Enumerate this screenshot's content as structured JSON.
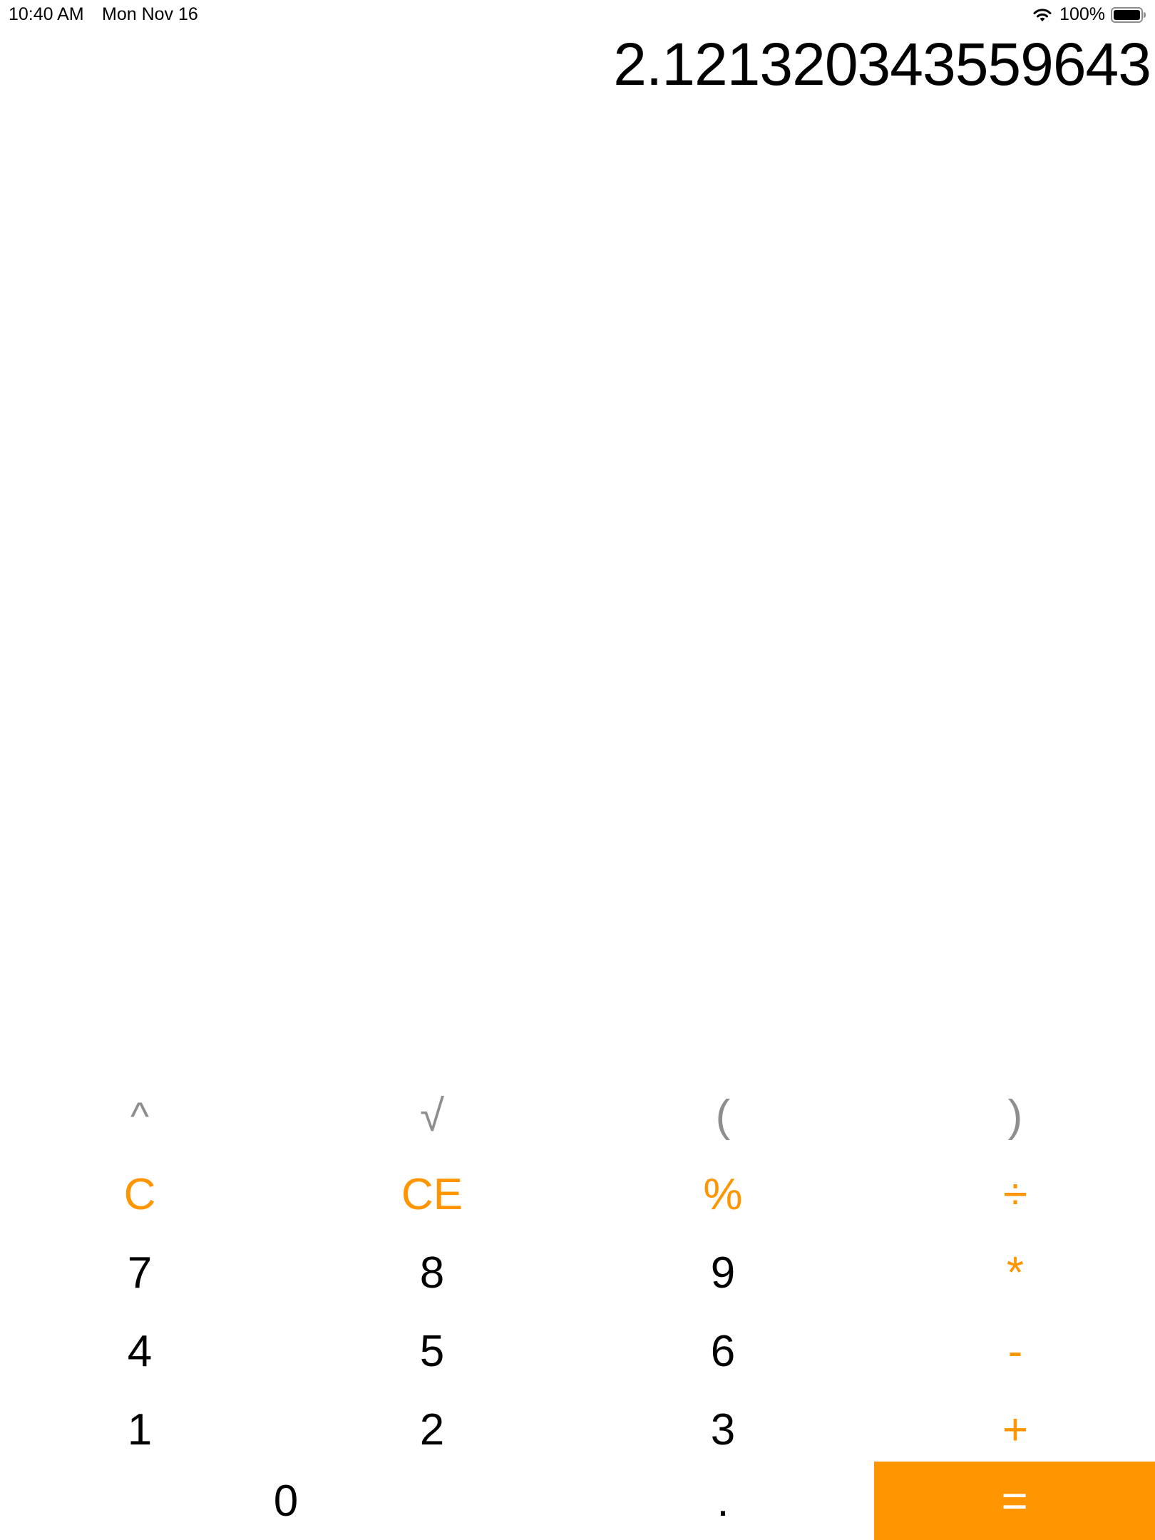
{
  "status_bar": {
    "time": "10:40 AM",
    "date": "Mon Nov 16",
    "battery_text": "100%",
    "wifi_icon": "wifi-icon",
    "battery_icon": "battery-icon"
  },
  "display": {
    "value": "2.121320343559643"
  },
  "keys": {
    "caret": "^",
    "sqrt": "√",
    "lparen": "(",
    "rparen": ")",
    "clear": "C",
    "clear_entry": "CE",
    "percent": "%",
    "divide": "÷",
    "seven": "7",
    "eight": "8",
    "nine": "9",
    "multiply": "*",
    "four": "4",
    "five": "5",
    "six": "6",
    "minus": "-",
    "one": "1",
    "two": "2",
    "three": "3",
    "plus": "+",
    "zero": "0",
    "decimal": ".",
    "equals": "="
  },
  "colors": {
    "accent": "#ff9500",
    "function_gray": "#8e8e8e",
    "digit": "#000000",
    "background": "#ffffff"
  }
}
